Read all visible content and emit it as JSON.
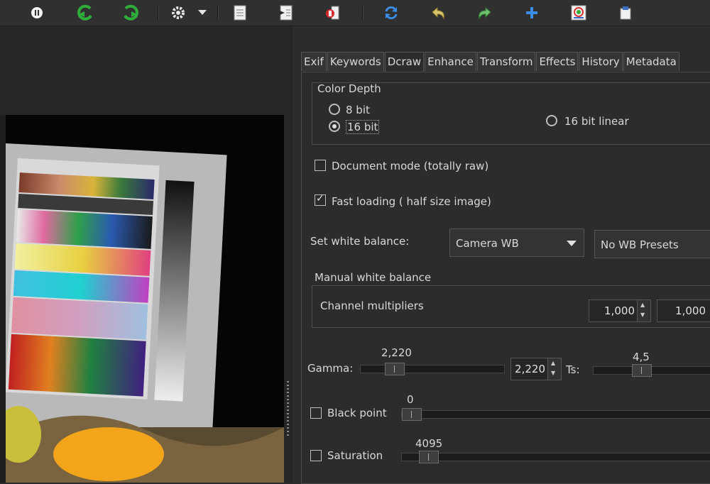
{
  "toolbar": {
    "icons": [
      "info-icon",
      "rotate-left-icon",
      "rotate-right-icon",
      "gear-icon",
      "dropdown-arrow-icon",
      "document-icon",
      "import-icon",
      "export-icon",
      "refresh-icon",
      "undo-icon",
      "redo-icon",
      "add-icon",
      "color-chart-icon",
      "clipboard-icon"
    ]
  },
  "tabs": [
    "Exif",
    "Keywords",
    "Dcraw",
    "Enhance",
    "Transform",
    "Effects",
    "History",
    "Metadata"
  ],
  "active_tab": "Dcraw",
  "color_depth": {
    "title": "Color Depth",
    "opt_8": "8 bit",
    "opt_16": "16 bit",
    "opt_16_linear": "16 bit linear",
    "selected": "16 bit"
  },
  "document_mode": {
    "label": "Document mode (totally raw)",
    "checked": false
  },
  "fast_loading": {
    "label": "Fast loading ( half size image)",
    "checked": true
  },
  "white_balance": {
    "label": "Set white balance:",
    "value": "Camera WB",
    "presets": "No WB Presets"
  },
  "manual_wb": {
    "title": "Manual white balance",
    "label": "Channel multipliers",
    "mult1": "1,000",
    "mult2": "1,000"
  },
  "gamma": {
    "label": "Gamma:",
    "value_top": "2,220",
    "spin_value": "2,220",
    "ts_label": "Ts:",
    "ts_value": "4,5"
  },
  "black_point": {
    "label": "Black point",
    "value": "0",
    "checked": false
  },
  "saturation": {
    "label": "Saturation",
    "value": "4095",
    "checked": false
  },
  "colors": {
    "bg": "#2b2b2b",
    "panel": "#2c2c2c",
    "text": "#d8d8d8",
    "green_icon": "#2fae3c",
    "blue_icon": "#3a8ee6"
  }
}
